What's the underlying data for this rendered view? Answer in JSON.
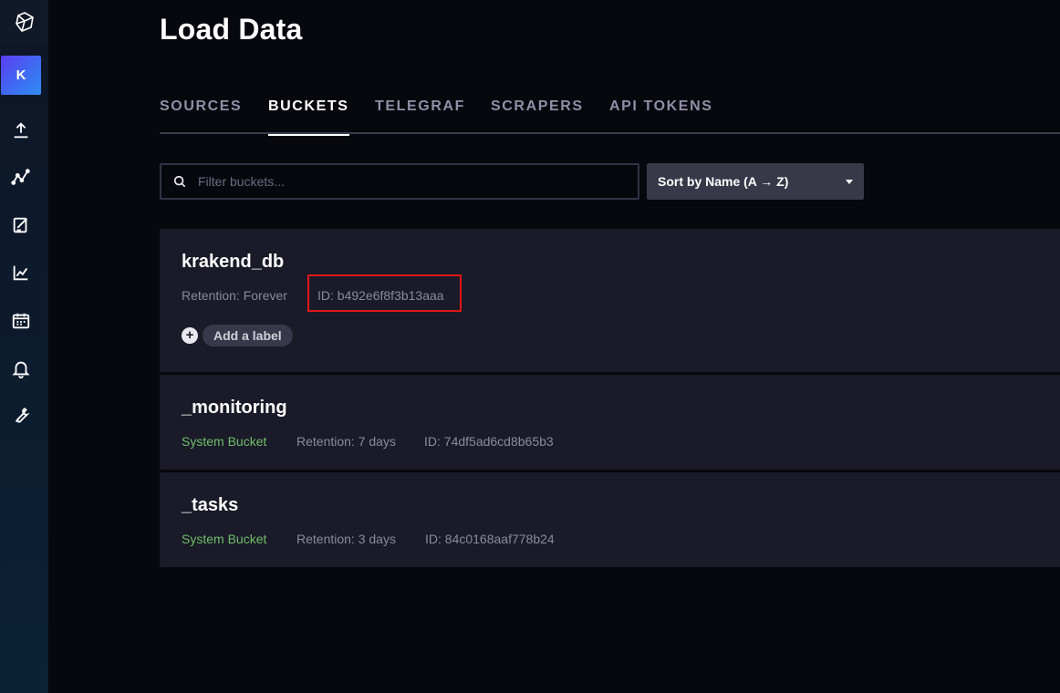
{
  "sidebar": {
    "avatar_letter": "K",
    "items": [
      {
        "icon": "logo-icon"
      },
      {
        "icon": "upload-icon"
      },
      {
        "icon": "data-explorer-icon"
      },
      {
        "icon": "notebook-edit-icon"
      },
      {
        "icon": "dashboards-icon"
      },
      {
        "icon": "tasks-calendar-icon"
      },
      {
        "icon": "alerts-bell-icon"
      },
      {
        "icon": "settings-wrench-icon"
      }
    ]
  },
  "page": {
    "title": "Load Data"
  },
  "tabs": [
    {
      "label": "SOURCES",
      "active": false
    },
    {
      "label": "BUCKETS",
      "active": true
    },
    {
      "label": "TELEGRAF",
      "active": false
    },
    {
      "label": "SCRAPERS",
      "active": false
    },
    {
      "label": "API TOKENS",
      "active": false
    }
  ],
  "search": {
    "placeholder": "Filter buckets...",
    "value": ""
  },
  "sort": {
    "label": "Sort by Name (A → Z)"
  },
  "buckets": [
    {
      "name": "krakend_db",
      "retention": "Retention: Forever",
      "id": "ID: b492e6f8f3b13aaa",
      "add_label": "Add a label",
      "plus": "+"
    },
    {
      "name": "_monitoring",
      "system": "System Bucket",
      "retention": "Retention: 7 days",
      "id": "ID: 74df5ad6cd8b65b3"
    },
    {
      "name": "_tasks",
      "system": "System Bucket",
      "retention": "Retention: 3 days",
      "id": "ID: 84c0168aaf778b24"
    }
  ],
  "colors": {
    "background": "#07070e",
    "card": "#1a1a28",
    "system_bucket": "#6fbf6a",
    "highlight": "#e01818"
  }
}
